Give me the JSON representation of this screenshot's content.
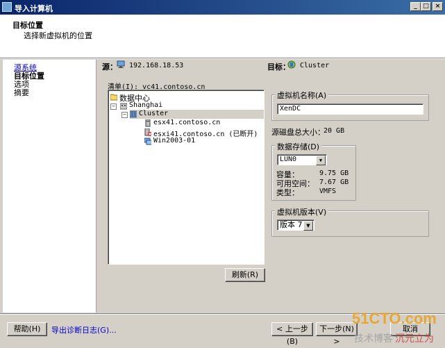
{
  "window": {
    "title": "导入计算机",
    "controls": [
      "_",
      "□",
      "×"
    ]
  },
  "header": {
    "title": "目标位置",
    "subtitle": "选择新虚拟机的位置"
  },
  "nav": {
    "items": [
      {
        "label": "源系统",
        "state": "link"
      },
      {
        "label": "目标位置",
        "state": "current"
      },
      {
        "label": "选项",
        "state": "normal"
      },
      {
        "label": "摘要",
        "state": "normal"
      }
    ]
  },
  "source": {
    "label": "源：",
    "value": "192.168.18.53"
  },
  "target": {
    "label": "目标：",
    "value": "Cluster"
  },
  "inventory": {
    "label": "清单(I): vc41.contoso.cn",
    "tree": [
      {
        "label": "数据中心",
        "icon": "folder-icon"
      },
      {
        "label": "Shanghai",
        "icon": "datacenter-icon"
      },
      {
        "label": "Cluster",
        "icon": "cluster-icon",
        "selected": true
      },
      {
        "label": "esx41.contoso.cn",
        "icon": "host-icon"
      },
      {
        "label": "esxi41.contoso.cn (已断开)",
        "icon": "host-disconnected-icon"
      },
      {
        "label": "Win2003-01",
        "icon": "vm-icon"
      }
    ]
  },
  "refresh_button": "刷新(R)",
  "vm_name": {
    "legend": "虚拟机名称(A)",
    "value": "XenDC"
  },
  "disk_total": {
    "label": "源磁盘总大小：",
    "value": "20 GB"
  },
  "datastore": {
    "legend": "数据存储(D)",
    "selected": "LUN0",
    "rows": [
      {
        "label": "容量：",
        "value": "9.75 GB"
      },
      {
        "label": "可用空间：",
        "value": "7.67 GB"
      },
      {
        "label": "类型：",
        "value": "VMFS"
      }
    ]
  },
  "vm_version": {
    "legend": "虚拟机版本(V)",
    "selected": "版本 7"
  },
  "footer": {
    "help": "帮助(H)",
    "export_log": "导出诊断日志(G)...",
    "back": "< 上一步(B)",
    "next": "下一步(N) >",
    "cancel": "取消"
  },
  "watermark": {
    "line1": "51CTO.com",
    "line2": "技术博客",
    "line3": "沉元立为"
  }
}
